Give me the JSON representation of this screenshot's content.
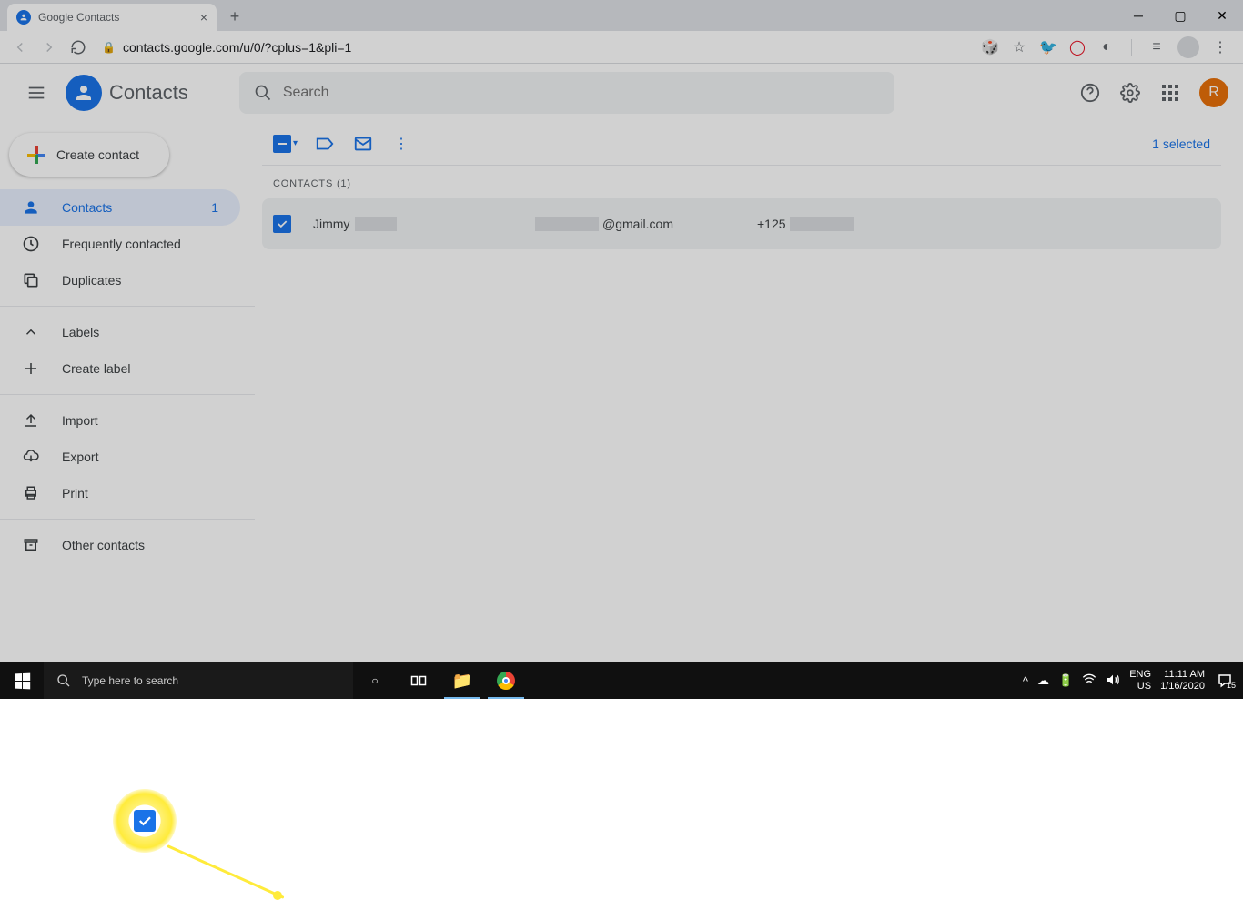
{
  "browser": {
    "tab_title": "Google Contacts",
    "url": "contacts.google.com/u/0/?cplus=1&pli=1"
  },
  "app": {
    "title": "Contacts",
    "search_placeholder": "Search",
    "avatar_letter": "R"
  },
  "sidebar": {
    "create_label": "Create contact",
    "items": [
      {
        "label": "Contacts",
        "count": "1",
        "active": true
      },
      {
        "label": "Frequently contacted"
      },
      {
        "label": "Duplicates"
      }
    ],
    "labels_header": "Labels",
    "create_label_label": "Create label",
    "import": "Import",
    "export": "Export",
    "print": "Print",
    "other": "Other contacts"
  },
  "toolbar": {
    "selected_text": "1 selected"
  },
  "list": {
    "header": "CONTACTS (1)",
    "rows": [
      {
        "name": "Jimmy",
        "email_suffix": "@gmail.com",
        "phone_prefix": "+125"
      }
    ]
  },
  "taskbar": {
    "search_placeholder": "Type here to search",
    "lang1": "ENG",
    "lang2": "US",
    "time": "11:11 AM",
    "date": "1/16/2020",
    "notif_count": "15"
  }
}
